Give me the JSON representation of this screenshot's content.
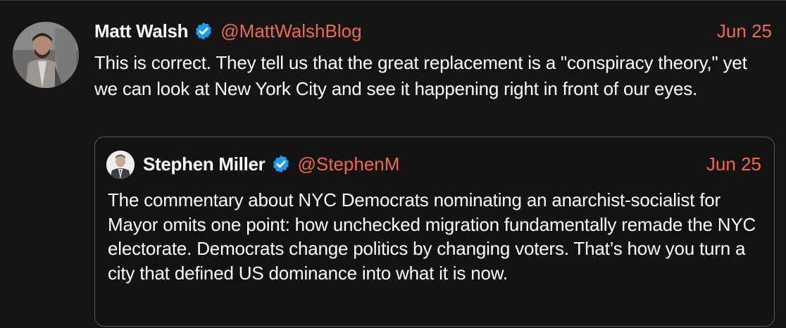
{
  "tweet": {
    "author": {
      "name": "Matt Walsh",
      "handle": "@MattWalshBlog",
      "verified_icon": "verified-badge-icon",
      "avatar_icon": "avatar-photo"
    },
    "date": "Jun 25",
    "text": "This is correct. They tell us that the great replacement is a \"conspiracy theory,\" yet we can look at New York City and see it happening right in front of our eyes."
  },
  "quote": {
    "author": {
      "name": "Stephen Miller",
      "handle": "@StephenM",
      "verified_icon": "verified-badge-icon",
      "avatar_icon": "avatar-photo"
    },
    "date": "Jun 25",
    "text": "The commentary about NYC Democrats nominating an anarchist-socialist for Mayor omits one point: how unchecked migration fundamentally remade the NYC electorate. Democrats change politics by changing voters. That’s how you turn a city that defined US dominance into what it is now."
  },
  "colors": {
    "background": "#151515",
    "text": "#ffffff",
    "accent": "#ef6a4e",
    "verified": "#1d9bf0",
    "quote_border": "#5a5a5a"
  }
}
